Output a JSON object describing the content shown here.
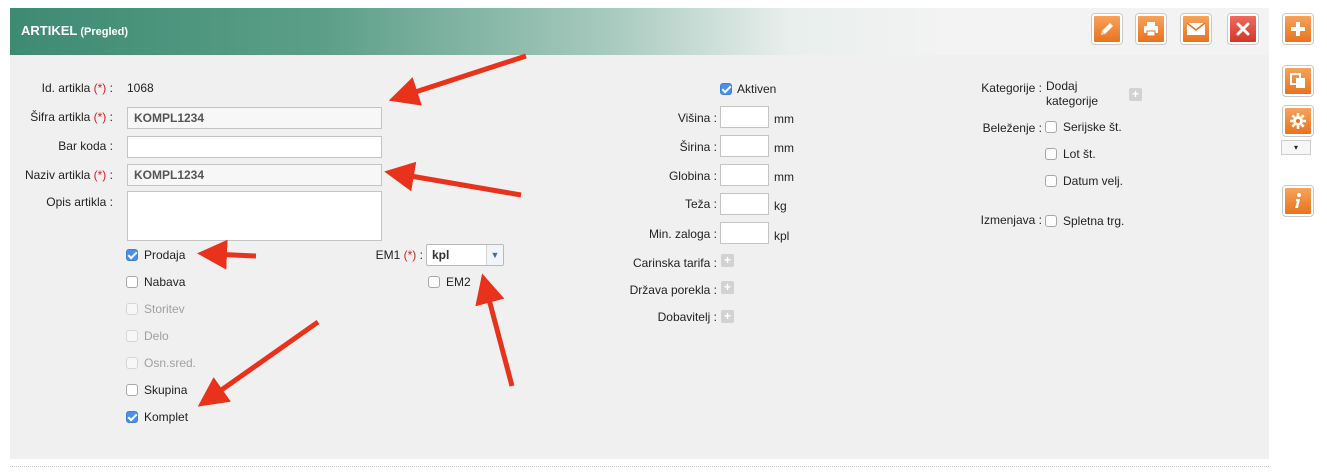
{
  "header": {
    "title": "ARTIKEL",
    "subtitle": "(Pregled)"
  },
  "toolbar": {
    "edit_icon": "pencil-icon",
    "print_icon": "printer-icon",
    "email_icon": "envelope-icon",
    "close_icon": "close-icon",
    "add_icon": "plus-icon",
    "copy_icon": "copy-icon",
    "settings_icon": "gear-icon",
    "dropdown_glyph": "▾",
    "info_icon": "info-icon"
  },
  "fields": {
    "id_label": "Id. artikla",
    "sifra_label": "Šifra artikla",
    "barkoda_label": "Bar koda",
    "naziv_label": "Naziv artikla",
    "opis_label": "Opis artikla",
    "required_mark": "(*)",
    "colon": ":",
    "id_value": "1068",
    "sifra_value": "KOMPL1234",
    "barkoda_value": "",
    "naziv_value": "KOMPL1234",
    "opis_value": ""
  },
  "flags": {
    "prodaja": "Prodaja",
    "nabava": "Nabava",
    "storitev": "Storitev",
    "delo": "Delo",
    "osnsred": "Osn.sred.",
    "skupina": "Skupina",
    "komplet": "Komplet"
  },
  "units": {
    "em1_label": "EM1",
    "em1_value": "kpl",
    "em2_label": "EM2"
  },
  "dimensions": {
    "aktiven": "Aktiven",
    "visina_label": "Višina",
    "sirina_label": "Širina",
    "globina_label": "Globina",
    "teza_label": "Teža",
    "minzaloga_label": "Min. zaloga",
    "carinska_label": "Carinska tarifa",
    "drzava_label": "Država porekla",
    "dobavitelj_label": "Dobavitelj",
    "mm": "mm",
    "kg": "kg",
    "kpl": "kpl",
    "plus": "+"
  },
  "categories": {
    "kategorije_label": "Kategorije",
    "dodaj_line1": "Dodaj",
    "dodaj_line2": "kategorije",
    "belezenje_label": "Beleženje",
    "serijske": "Serijske št.",
    "lot": "Lot št.",
    "datum": "Datum velj.",
    "izmenjava_label": "Izmenjava",
    "spletna": "Spletna trg."
  },
  "colors": {
    "header_accent": "#3d8a72",
    "toolbar_orange": "#e8731f",
    "toolbar_red": "#d6352a",
    "annotation_arrow": "#e8321b",
    "required": "#d42020",
    "checkbox_checked": "#4a8fe8"
  }
}
